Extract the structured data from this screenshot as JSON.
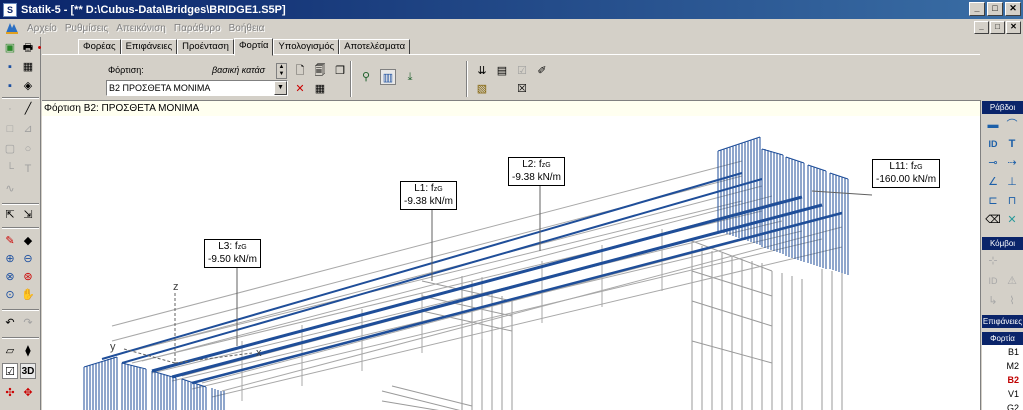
{
  "window": {
    "app_name": "Statik-5",
    "title": "Statik-5 - [** D:\\Cubus-Data\\Bridges\\BRIDGE1.S5P]",
    "controls": {
      "minimize": "_",
      "maximize": "□",
      "close": "✕"
    }
  },
  "menu": {
    "items": [
      "Αρχείο",
      "Ρυθμίσεις",
      "Απεικόνιση",
      "Παράθυρο",
      "Βοήθεια"
    ]
  },
  "tabs": {
    "items": [
      "Φορέας",
      "Επιφάνειες",
      "Προένταση",
      "Φορτία",
      "Υπολογισμός",
      "Αποτελέσματα"
    ],
    "active": "Φορτία"
  },
  "ribbon": {
    "load_label": "Φόρτιση:",
    "load_type": "βασική κατάσ",
    "load_case_selected": "B2  ΠΡΟΣΘΕΤΑ ΜΟΝΙΜΑ"
  },
  "viewport": {
    "header": "Φόρτιση B2: ΠΡΟΣΘΕΤΑ ΜΟΝΙΜΑ",
    "axes": {
      "z": "z",
      "y": "y",
      "x": "x"
    },
    "loads": [
      {
        "id": "L3",
        "title": "L3: f",
        "sub": "zG",
        "value": "-9.50 kN/m"
      },
      {
        "id": "L1",
        "title": "L1: f",
        "sub": "zG",
        "value": "-9.38 kN/m"
      },
      {
        "id": "L2",
        "title": "L2: f",
        "sub": "zG",
        "value": "-9.38 kN/m"
      },
      {
        "id": "L11",
        "title": "L11: f",
        "sub": "zG",
        "value": "-160.00 kN/m"
      }
    ]
  },
  "right_panel": {
    "sections": {
      "rods": "Ράβδοι",
      "nodes": "Κόμβοι",
      "surfaces": "Επιφάνειες",
      "loads": "Φορτία"
    },
    "load_cases": [
      "B1",
      "M2",
      "B2",
      "V1",
      "G2"
    ],
    "selected_case": "B2"
  },
  "left_toolbar": {
    "three_d_label": "3D"
  },
  "colors": {
    "title_bar": "#0a246a",
    "load_blue": "#1f4e99",
    "wire_gray": "#9a9a9a",
    "selected_red": "#c00000"
  }
}
